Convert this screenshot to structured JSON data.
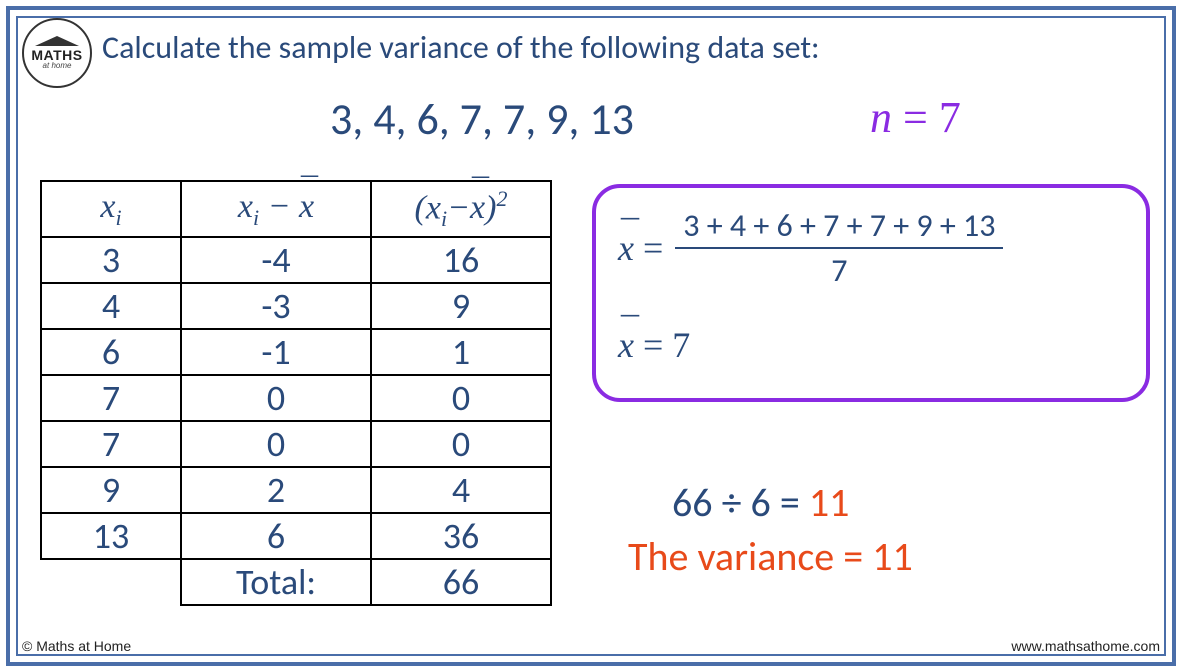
{
  "logo": {
    "main": "MATHS",
    "sub": "at home"
  },
  "title": "Calculate the sample variance of the following data set:",
  "dataset": "3, 4, 6, 7, 7, 9, 13",
  "n_equation": "n = 7",
  "table": {
    "headers": {
      "c1": "xᵢ",
      "c2": "xᵢ − x̄",
      "c3": "(xᵢ−x̄)²"
    },
    "rows": [
      {
        "xi": "3",
        "dev": "-4",
        "sq": "16"
      },
      {
        "xi": "4",
        "dev": "-3",
        "sq": "9"
      },
      {
        "xi": "6",
        "dev": "-1",
        "sq": "1"
      },
      {
        "xi": "7",
        "dev": "0",
        "sq": "0"
      },
      {
        "xi": "7",
        "dev": "0",
        "sq": "0"
      },
      {
        "xi": "9",
        "dev": "2",
        "sq": "4"
      },
      {
        "xi": "13",
        "dev": "6",
        "sq": "36"
      }
    ],
    "total_label": "Total:",
    "total_value": "66"
  },
  "mean": {
    "lhs": "x̄ =",
    "numerator": "3 + 4 + 6 + 7 + 7 + 9 + 13",
    "denominator": "7",
    "result": "x̄ = 7"
  },
  "variance": {
    "calc_lhs": "66 ÷ 6 =",
    "calc_result": "11",
    "statement": "The variance = 11"
  },
  "footer": {
    "left": "© Maths at Home",
    "right": "www.mathsathome.com"
  },
  "chart_data": {
    "type": "table",
    "title": "Sample variance calculation",
    "data_values": [
      3,
      4,
      6,
      7,
      7,
      9,
      13
    ],
    "n": 7,
    "mean": 7,
    "deviations": [
      -4,
      -3,
      -1,
      0,
      0,
      2,
      6
    ],
    "squared_deviations": [
      16,
      9,
      1,
      0,
      0,
      4,
      36
    ],
    "sum_squared_deviations": 66,
    "divisor": 6,
    "sample_variance": 11
  }
}
